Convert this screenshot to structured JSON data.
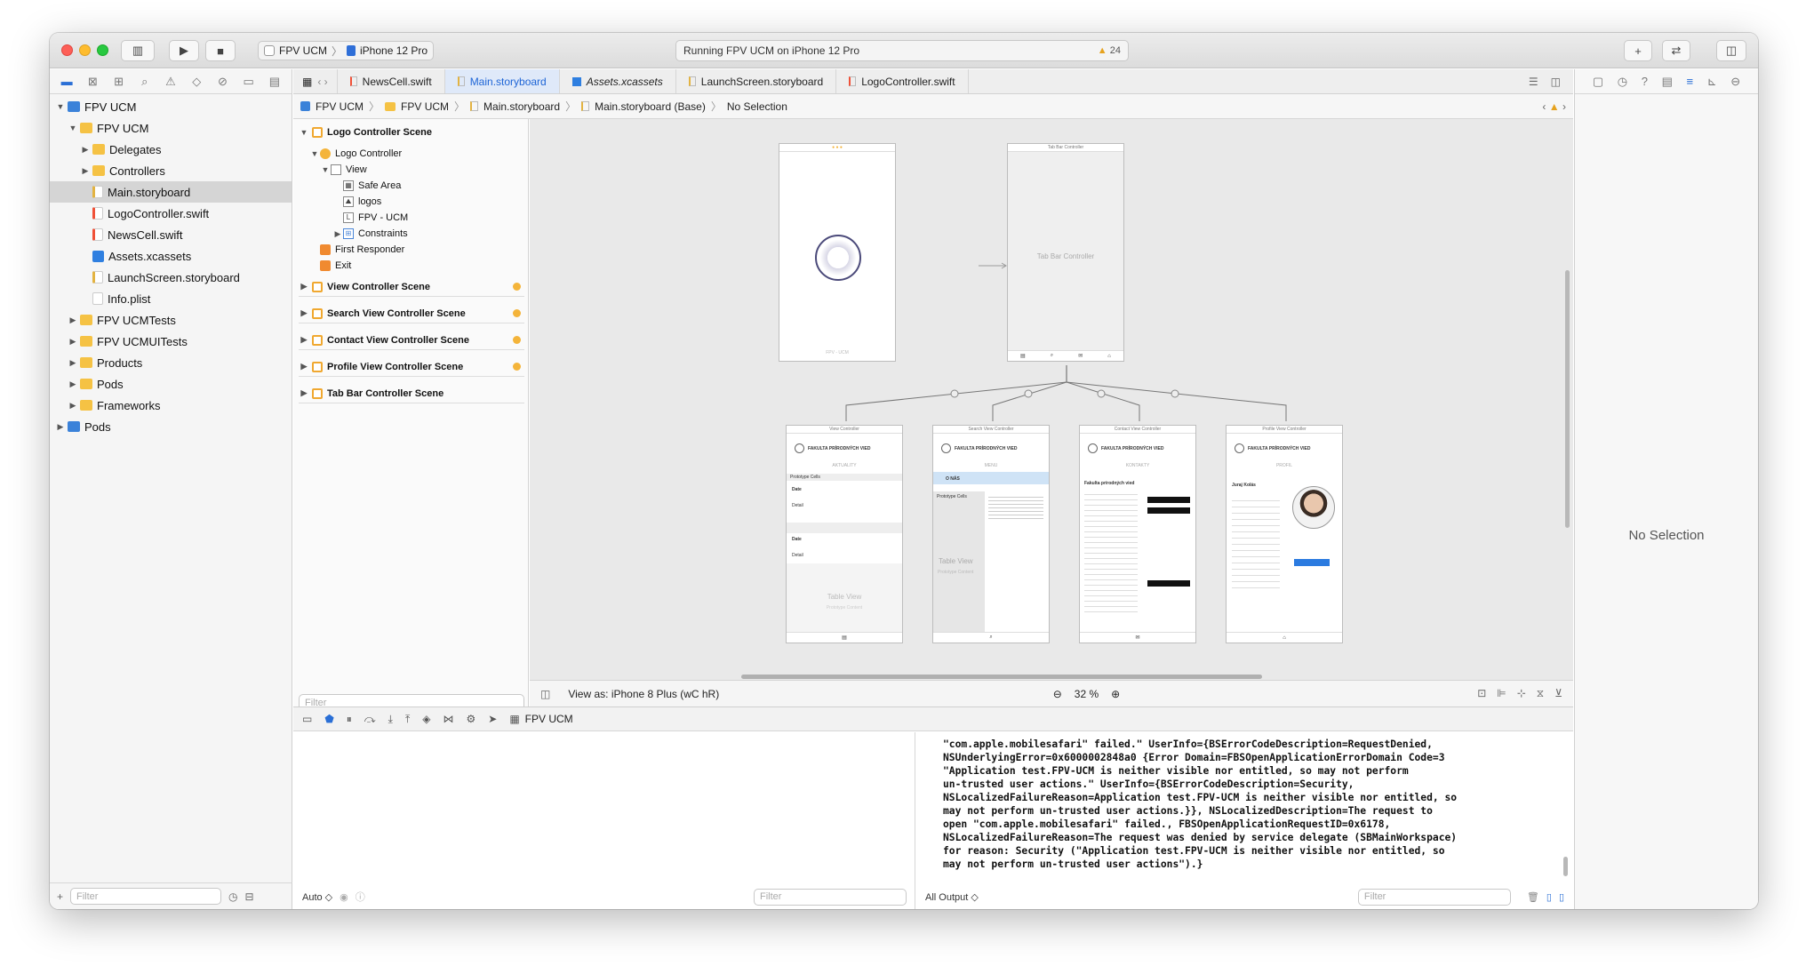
{
  "toolbar": {
    "scheme": "FPV UCM",
    "device": "iPhone 12 Pro",
    "activity": "Running FPV UCM on iPhone 12 Pro",
    "warnings": "24",
    "plus": "+",
    "swap": "⇄"
  },
  "navigator": {
    "items": [
      {
        "label": "FPV UCM",
        "indent": 0,
        "disc": "▼",
        "icon": "proj"
      },
      {
        "label": "FPV UCM",
        "indent": 1,
        "disc": "▼",
        "icon": "folder"
      },
      {
        "label": "Delegates",
        "indent": 2,
        "disc": "▶",
        "icon": "folder"
      },
      {
        "label": "Controllers",
        "indent": 2,
        "disc": "▶",
        "icon": "folder"
      },
      {
        "label": "Main.storyboard",
        "indent": 2,
        "disc": "",
        "icon": "file-sb",
        "selected": true
      },
      {
        "label": "LogoController.swift",
        "indent": 2,
        "disc": "",
        "icon": "file-swift"
      },
      {
        "label": "NewsCell.swift",
        "indent": 2,
        "disc": "",
        "icon": "file-swift"
      },
      {
        "label": "Assets.xcassets",
        "indent": 2,
        "disc": "",
        "icon": "file-xc"
      },
      {
        "label": "LaunchScreen.storyboard",
        "indent": 2,
        "disc": "",
        "icon": "file-sb"
      },
      {
        "label": "Info.plist",
        "indent": 2,
        "disc": "",
        "icon": "file-pl"
      },
      {
        "label": "FPV UCMTests",
        "indent": 1,
        "disc": "▶",
        "icon": "folder"
      },
      {
        "label": "FPV UCMUITests",
        "indent": 1,
        "disc": "▶",
        "icon": "folder"
      },
      {
        "label": "Products",
        "indent": 1,
        "disc": "▶",
        "icon": "folder"
      },
      {
        "label": "Pods",
        "indent": 1,
        "disc": "▶",
        "icon": "folder"
      },
      {
        "label": "Frameworks",
        "indent": 1,
        "disc": "▶",
        "icon": "folder"
      },
      {
        "label": "Pods",
        "indent": 0,
        "disc": "▶",
        "icon": "proj"
      }
    ],
    "filter_placeholder": "Filter"
  },
  "tabs": [
    "NewsCell.swift",
    "Main.storyboard",
    "Assets.xcassets",
    "LaunchScreen.storyboard",
    "LogoController.swift"
  ],
  "jumpbar": [
    "FPV UCM",
    "FPV UCM",
    "Main.storyboard",
    "Main.storyboard (Base)",
    "No Selection"
  ],
  "outline": {
    "logo_scene": "Logo Controller Scene",
    "logo_controller": "Logo Controller",
    "view": "View",
    "safe_area": "Safe Area",
    "logos": "logos",
    "fpv_label": "FPV - UCM",
    "constraints": "Constraints",
    "first_responder": "First Responder",
    "exit": "Exit",
    "scenes": [
      "View Controller Scene",
      "Search View Controller Scene",
      "Contact View Controller Scene",
      "Profile View Controller Scene",
      "Tab Bar Controller Scene"
    ],
    "filter_placeholder": "Filter"
  },
  "canvas": {
    "tab_bar_title": "Tab Bar Controller",
    "tab_bar_label": "Tab Bar Controller",
    "logo_footer": "FPV - UCM",
    "faculty": "FAKULTA PRÍRODNÝCH VIED",
    "screens": [
      {
        "title": "View Controller",
        "section": "AKTUALITY"
      },
      {
        "title": "Search View Controller",
        "section": "MENU"
      },
      {
        "title": "Contact View Controller",
        "section": "KONTAKTY"
      },
      {
        "title": "Profile View Controller",
        "section": "PROFIL"
      }
    ],
    "prototype_cells": "Prototype Cells",
    "table_view": "Table View",
    "prototype_content": "Prototype Content",
    "date_label": "Date",
    "detail_label": "Detail",
    "o_nas": "O NÁS",
    "profile_name": "Juraj Kolás",
    "contact_title": "Fakulta prírodných vied"
  },
  "inspector_bar": {
    "view_as": "View as: iPhone 8 Plus (wC hR)",
    "zoom": "32 %"
  },
  "debug_bar": {
    "target": "FPV UCM"
  },
  "console": {
    "text": "\"com.apple.mobilesafari\" failed.\" UserInfo={BSErrorCodeDescription=RequestDenied,\nNSUnderlyingError=0x6000002848a0 {Error Domain=FBSOpenApplicationErrorDomain Code=3\n\"Application test.FPV-UCM is neither visible nor entitled, so may not perform\nun-trusted user actions.\" UserInfo={BSErrorCodeDescription=Security,\nNSLocalizedFailureReason=Application test.FPV-UCM is neither visible nor entitled, so\nmay not perform un-trusted user actions.}}, NSLocalizedDescription=The request to\nopen \"com.apple.mobilesafari\" failed., FBSOpenApplicationRequestID=0x6178,\nNSLocalizedFailureReason=The request was denied by service delegate (SBMainWorkspace)\nfor reason: Security (\"Application test.FPV-UCM is neither visible nor entitled, so\nmay not perform un-trusted user actions\").}",
    "output_select": "All Output ◇",
    "auto_select": "Auto ◇",
    "filter_placeholder": "Filter"
  },
  "inspector": {
    "no_selection": "No Selection"
  },
  "colors": {
    "accent": "#1d64d6",
    "warning": "#f4b43a",
    "folder": "#f5c244"
  }
}
